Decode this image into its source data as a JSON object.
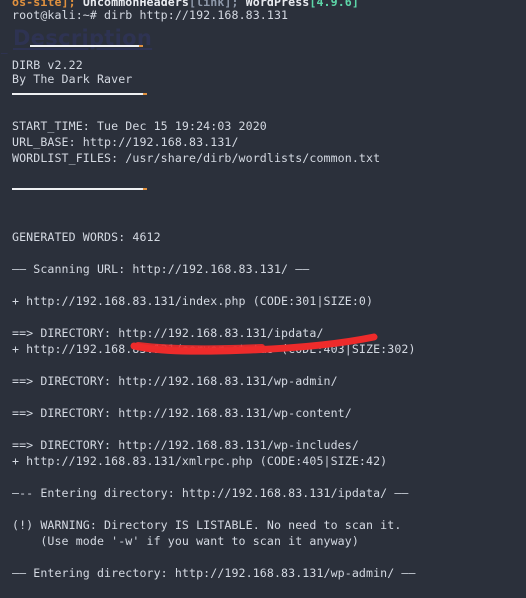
{
  "terminal": {
    "background_color": "#2b303b",
    "foreground_color": "#d8dee9",
    "accent_orange": "#e0913f",
    "accent_green": "#5dd6a8",
    "top_clipped_line": {
      "seg1": "os-site];",
      "seg2": " UncommonHeaders",
      "seg3": "[link];",
      "seg4": " WordPress",
      "seg5": "[4.9.6]"
    },
    "prompt_line": {
      "prompt": "root@kali:~# ",
      "command": "dirb http://192.168.83.131"
    },
    "lines": [
      "DIRB v2.22",
      "By The Dark Raver",
      "START_TIME: Tue Dec 15 19:24:03 2020",
      "URL_BASE: http://192.168.83.131/",
      "WORDLIST_FILES: /usr/share/dirb/wordlists/common.txt",
      "GENERATED WORDS: 4612",
      "—— Scanning URL: http://192.168.83.131/ ——",
      "+ http://192.168.83.131/index.php (CODE:301|SIZE:0)",
      "==> DIRECTORY: http://192.168.83.131/ipdata/",
      "+ http://192.168.83.131/server-status (CODE:403|SIZE:302)",
      "==> DIRECTORY: http://192.168.83.131/wp-admin/",
      "==> DIRECTORY: http://192.168.83.131/wp-content/",
      "==> DIRECTORY: http://192.168.83.131/wp-includes/",
      "+ http://192.168.83.131/xmlrpc.php (CODE:405|SIZE:42)",
      "—-- Entering directory: http://192.168.83.131/ipdata/ ——",
      "(!) WARNING: Directory IS LISTABLE. No need to scan it.",
      "    (Use mode '-w' if you want to scan it anyway)",
      "—— Entering directory: http://192.168.83.131/wp-admin/ ——"
    ]
  },
  "overlay": {
    "heading": "Description",
    "annotation_color": "#ee2b2b"
  }
}
